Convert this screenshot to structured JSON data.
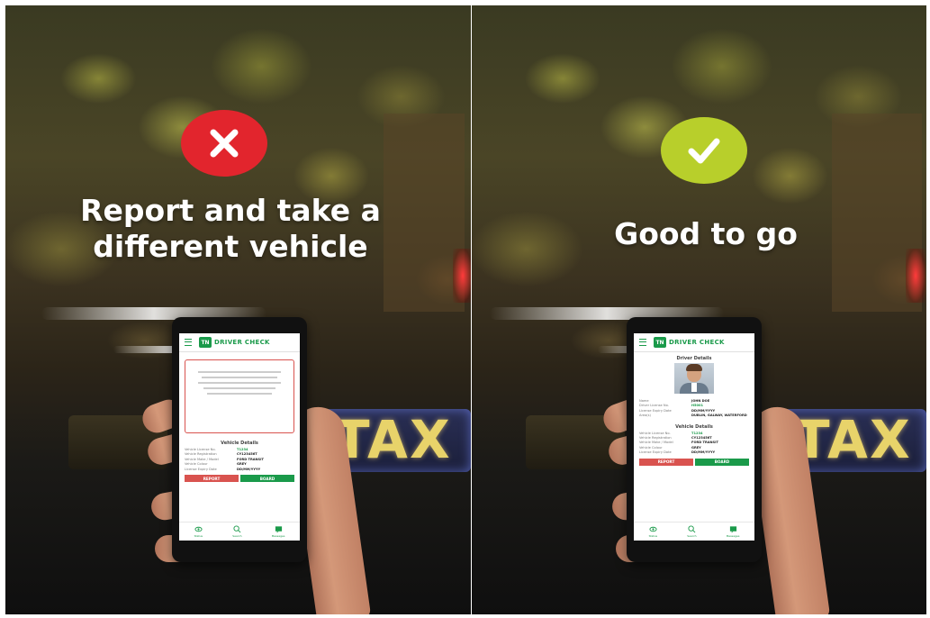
{
  "left": {
    "badge": "close-icon",
    "badge_color": "#e2252d",
    "headline_line1": "Report and take a",
    "headline_line2": "different vehicle",
    "taxi_sign": "TAX",
    "phone": {
      "app_title": "DRIVER CHECK",
      "logo": "TN",
      "warning": "",
      "section_title": "Vehicle Details",
      "rows": [
        {
          "k": "Vehicle License No.",
          "v": "T1234"
        },
        {
          "k": "Vehicle Registration",
          "v": "CY123456T"
        },
        {
          "k": "Vehicle Make / Model",
          "v": "FORD TRANSIT"
        },
        {
          "k": "Vehicle Colour",
          "v": "GREY"
        },
        {
          "k": "License Expiry Date",
          "v": "DD/MM/YYYY"
        }
      ],
      "report_label": "REPORT",
      "board_label": "BOARD",
      "nav": [
        "Status",
        "Search",
        "Messages"
      ]
    }
  },
  "right": {
    "badge": "check-icon",
    "badge_color": "#b8cf2b",
    "headline": "Good to go",
    "taxi_sign": "TAX",
    "phone": {
      "app_title": "DRIVER CHECK",
      "logo": "TN",
      "driver_title": "Driver Details",
      "driver_rows": [
        {
          "k": "Name",
          "v": "JOHN DOE"
        },
        {
          "k": "Driver License No.",
          "v": "H5001"
        },
        {
          "k": "License Expiry Date",
          "v": "DD/MM/YYYY"
        },
        {
          "k": "Area(s)",
          "v": "DUBLIN, GALWAY, WATERFORD"
        }
      ],
      "section_title": "Vehicle Details",
      "rows": [
        {
          "k": "Vehicle License No.",
          "v": "T1234"
        },
        {
          "k": "Vehicle Registration",
          "v": "CY123456T"
        },
        {
          "k": "Vehicle Make / Model",
          "v": "FORD TRANSIT"
        },
        {
          "k": "Vehicle Colour",
          "v": "GREY"
        },
        {
          "k": "License Expiry Date",
          "v": "DD/MM/YYYY"
        }
      ],
      "report_label": "REPORT",
      "board_label": "BOARD",
      "nav": [
        "Status",
        "Search",
        "Messages"
      ]
    }
  }
}
